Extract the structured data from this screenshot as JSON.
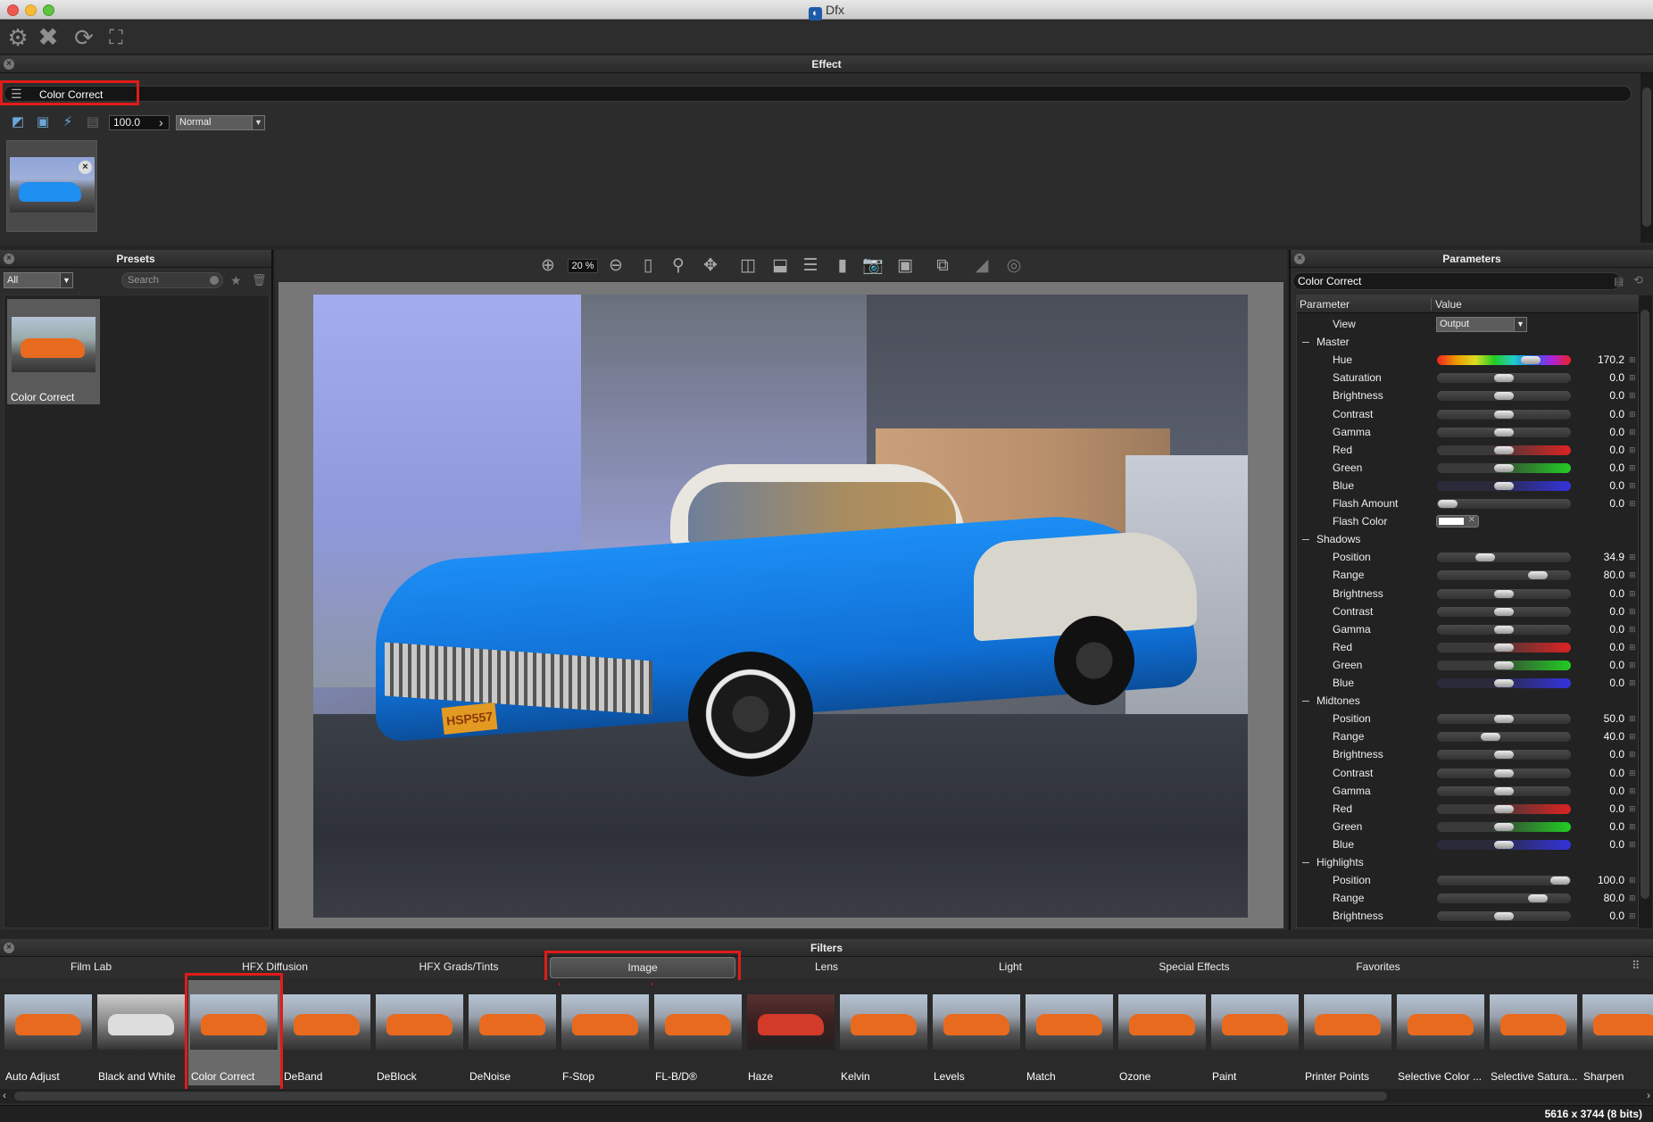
{
  "window": {
    "title": "Dfx"
  },
  "toolbar": {
    "icons": [
      "gear-icon",
      "close-icon",
      "refresh-icon",
      "fullscreen-icon"
    ]
  },
  "effect_panel": {
    "title": "Effect",
    "effect_name": "Color Correct",
    "opacity": "100.0",
    "blend_mode": "Normal"
  },
  "presets_panel": {
    "title": "Presets",
    "filter": "All",
    "search_placeholder": "Search",
    "items": [
      {
        "label": "Color Correct"
      }
    ]
  },
  "viewer": {
    "zoom": "20 %"
  },
  "parameters_panel": {
    "title": "Parameters",
    "preset_name": "Color Correct",
    "col_parameter": "Parameter",
    "col_value": "Value",
    "view": {
      "label": "View",
      "value": "Output"
    },
    "master": {
      "label": "Master",
      "rows": [
        {
          "label": "Hue",
          "value": "170.2",
          "pos": 0.7,
          "color": "hue"
        },
        {
          "label": "Saturation",
          "value": "0.0",
          "pos": 0.5,
          "color": "gray"
        },
        {
          "label": "Brightness",
          "value": "0.0",
          "pos": 0.5,
          "color": "gray"
        },
        {
          "label": "Contrast",
          "value": "0.0",
          "pos": 0.5,
          "color": "gray"
        },
        {
          "label": "Gamma",
          "value": "0.0",
          "pos": 0.5,
          "color": "gray"
        },
        {
          "label": "Red",
          "value": "0.0",
          "pos": 0.5,
          "color": "red"
        },
        {
          "label": "Green",
          "value": "0.0",
          "pos": 0.5,
          "color": "green"
        },
        {
          "label": "Blue",
          "value": "0.0",
          "pos": 0.5,
          "color": "blue"
        },
        {
          "label": "Flash Amount",
          "value": "0.0",
          "pos": 0.08,
          "color": "gray"
        }
      ],
      "flash_color_label": "Flash Color",
      "flash_color": "#ffffff"
    },
    "shadows": {
      "label": "Shadows",
      "rows": [
        {
          "label": "Position",
          "value": "34.9",
          "pos": 0.36,
          "color": "gray"
        },
        {
          "label": "Range",
          "value": "80.0",
          "pos": 0.75,
          "color": "gray"
        },
        {
          "label": "Brightness",
          "value": "0.0",
          "pos": 0.5,
          "color": "gray"
        },
        {
          "label": "Contrast",
          "value": "0.0",
          "pos": 0.5,
          "color": "gray"
        },
        {
          "label": "Gamma",
          "value": "0.0",
          "pos": 0.5,
          "color": "gray"
        },
        {
          "label": "Red",
          "value": "0.0",
          "pos": 0.5,
          "color": "red"
        },
        {
          "label": "Green",
          "value": "0.0",
          "pos": 0.5,
          "color": "green"
        },
        {
          "label": "Blue",
          "value": "0.0",
          "pos": 0.5,
          "color": "blue"
        }
      ]
    },
    "midtones": {
      "label": "Midtones",
      "rows": [
        {
          "label": "Position",
          "value": "50.0",
          "pos": 0.5,
          "color": "gray"
        },
        {
          "label": "Range",
          "value": "40.0",
          "pos": 0.4,
          "color": "gray"
        },
        {
          "label": "Brightness",
          "value": "0.0",
          "pos": 0.5,
          "color": "gray"
        },
        {
          "label": "Contrast",
          "value": "0.0",
          "pos": 0.5,
          "color": "gray"
        },
        {
          "label": "Gamma",
          "value": "0.0",
          "pos": 0.5,
          "color": "gray"
        },
        {
          "label": "Red",
          "value": "0.0",
          "pos": 0.5,
          "color": "red"
        },
        {
          "label": "Green",
          "value": "0.0",
          "pos": 0.5,
          "color": "green"
        },
        {
          "label": "Blue",
          "value": "0.0",
          "pos": 0.5,
          "color": "blue"
        }
      ]
    },
    "highlights": {
      "label": "Highlights",
      "rows": [
        {
          "label": "Position",
          "value": "100.0",
          "pos": 0.92,
          "color": "gray"
        },
        {
          "label": "Range",
          "value": "80.0",
          "pos": 0.75,
          "color": "gray"
        },
        {
          "label": "Brightness",
          "value": "0.0",
          "pos": 0.5,
          "color": "gray"
        }
      ]
    }
  },
  "filters_panel": {
    "title": "Filters",
    "tabs": [
      "Film Lab",
      "HFX Diffusion",
      "HFX Grads/Tints",
      "Image",
      "Lens",
      "Light",
      "Special Effects",
      "Favorites"
    ],
    "selected_tab": "Image",
    "items": [
      "Auto Adjust",
      "Black and White",
      "Color Correct",
      "DeBand",
      "DeBlock",
      "DeNoise",
      "F-Stop",
      "FL-B/D®",
      "Haze",
      "Kelvin",
      "Levels",
      "Match",
      "Ozone",
      "Paint",
      "Printer Points",
      "Selective Color ...",
      "Selective Satura...",
      "Sharpen"
    ],
    "selected_item": "Color Correct"
  },
  "status": {
    "text": "5616 x 3744 (8 bits)"
  },
  "colors": {
    "highlight_red": "#e01b1b",
    "panel_bg": "#2c2c2c"
  }
}
